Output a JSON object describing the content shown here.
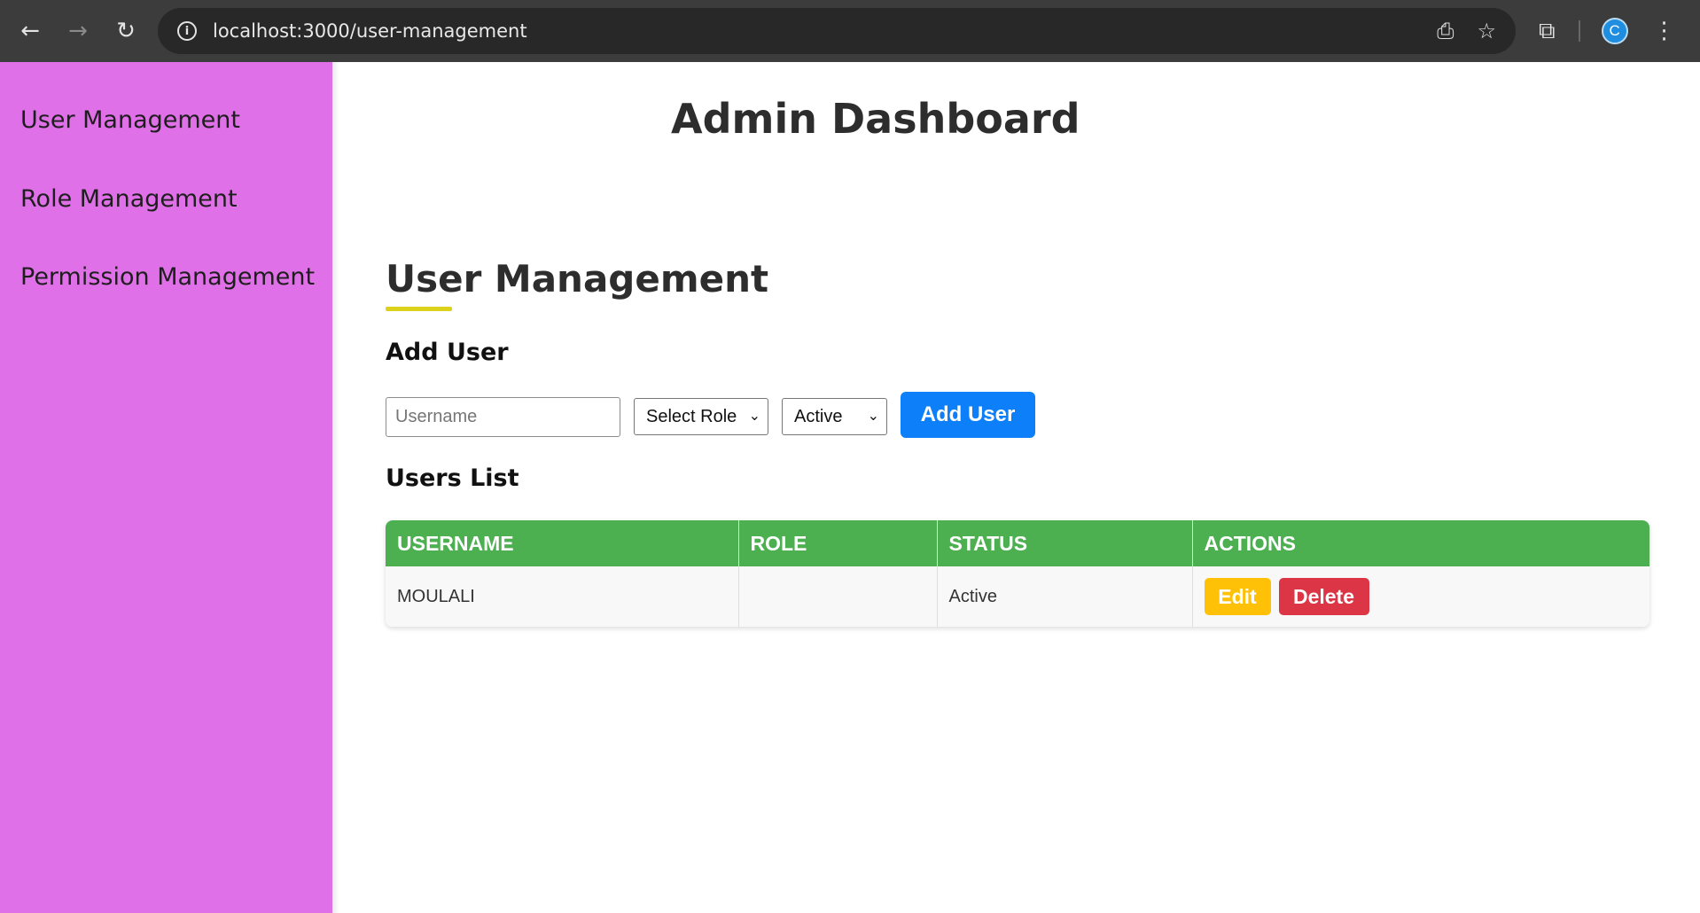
{
  "browser": {
    "url": "localhost:3000/user-management",
    "avatar_letter": "C"
  },
  "sidebar": {
    "items": [
      {
        "label": "User Management"
      },
      {
        "label": "Role Management"
      },
      {
        "label": "Permission Management"
      }
    ]
  },
  "main": {
    "dashboard_title": "Admin Dashboard",
    "section_title": "User Management",
    "add_user_heading": "Add User",
    "username_placeholder": "Username",
    "role_select_value": "Select Role",
    "status_select_value": "Active",
    "add_user_button": "Add User",
    "users_list_heading": "Users List"
  },
  "table": {
    "headers": [
      "USERNAME",
      "ROLE",
      "STATUS",
      "ACTIONS"
    ],
    "rows": [
      {
        "username": "MOULALI",
        "role": "",
        "status": "Active",
        "edit_label": "Edit",
        "delete_label": "Delete"
      }
    ]
  },
  "colors": {
    "sidebar_bg": "#e070e8",
    "primary": "#0d7ff8",
    "table_header": "#4caf50",
    "edit": "#ffc107",
    "delete": "#dc3545",
    "underline": "#dcd21c"
  }
}
